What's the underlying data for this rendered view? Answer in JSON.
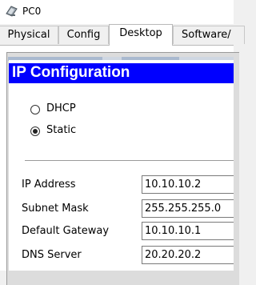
{
  "window": {
    "title": "PC0",
    "icon": "pc-app-icon"
  },
  "tabs": [
    {
      "label": "Physical",
      "active": false
    },
    {
      "label": "Config",
      "active": false
    },
    {
      "label": "Desktop",
      "active": true
    },
    {
      "label": "Software/",
      "active": false
    }
  ],
  "ip_config": {
    "title": "IP Configuration",
    "header_color": "#0000ff",
    "mode_options": [
      {
        "label": "DHCP",
        "selected": false
      },
      {
        "label": "Static",
        "selected": true
      }
    ],
    "fields": [
      {
        "label": "IP Address",
        "value": "10.10.10.2"
      },
      {
        "label": "Subnet Mask",
        "value": "255.255.255.0"
      },
      {
        "label": "Default Gateway",
        "value": "10.10.10.1"
      },
      {
        "label": "DNS Server",
        "value": "20.20.20.2"
      }
    ]
  }
}
